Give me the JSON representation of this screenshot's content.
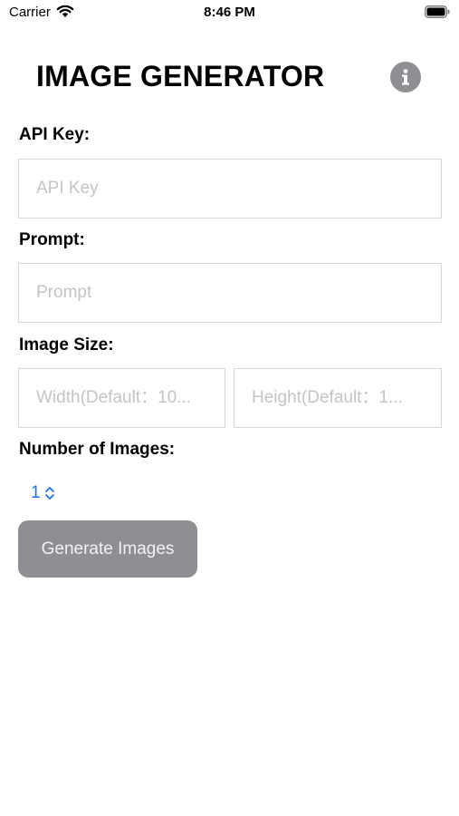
{
  "status_bar": {
    "carrier": "Carrier",
    "time": "8:46 PM"
  },
  "header": {
    "title": "IMAGE GENERATOR",
    "info_icon": "info-circle-icon"
  },
  "form": {
    "api_key": {
      "label": "API Key:",
      "value": "",
      "placeholder": "API Key"
    },
    "prompt": {
      "label": "Prompt:",
      "value": "",
      "placeholder": "Prompt"
    },
    "image_size": {
      "label": "Image Size:",
      "width": {
        "value": "",
        "placeholder": "Width(Default：10..."
      },
      "height": {
        "value": "",
        "placeholder": "Height(Default：1..."
      }
    },
    "number_of_images": {
      "label": "Number of Images:",
      "selected": "1"
    },
    "generate_label": "Generate Images"
  },
  "colors": {
    "accent": "#1a73e8",
    "button_disabled": "#8e8e93",
    "border": "#d8d8dc",
    "placeholder": "#c4c4c8"
  }
}
